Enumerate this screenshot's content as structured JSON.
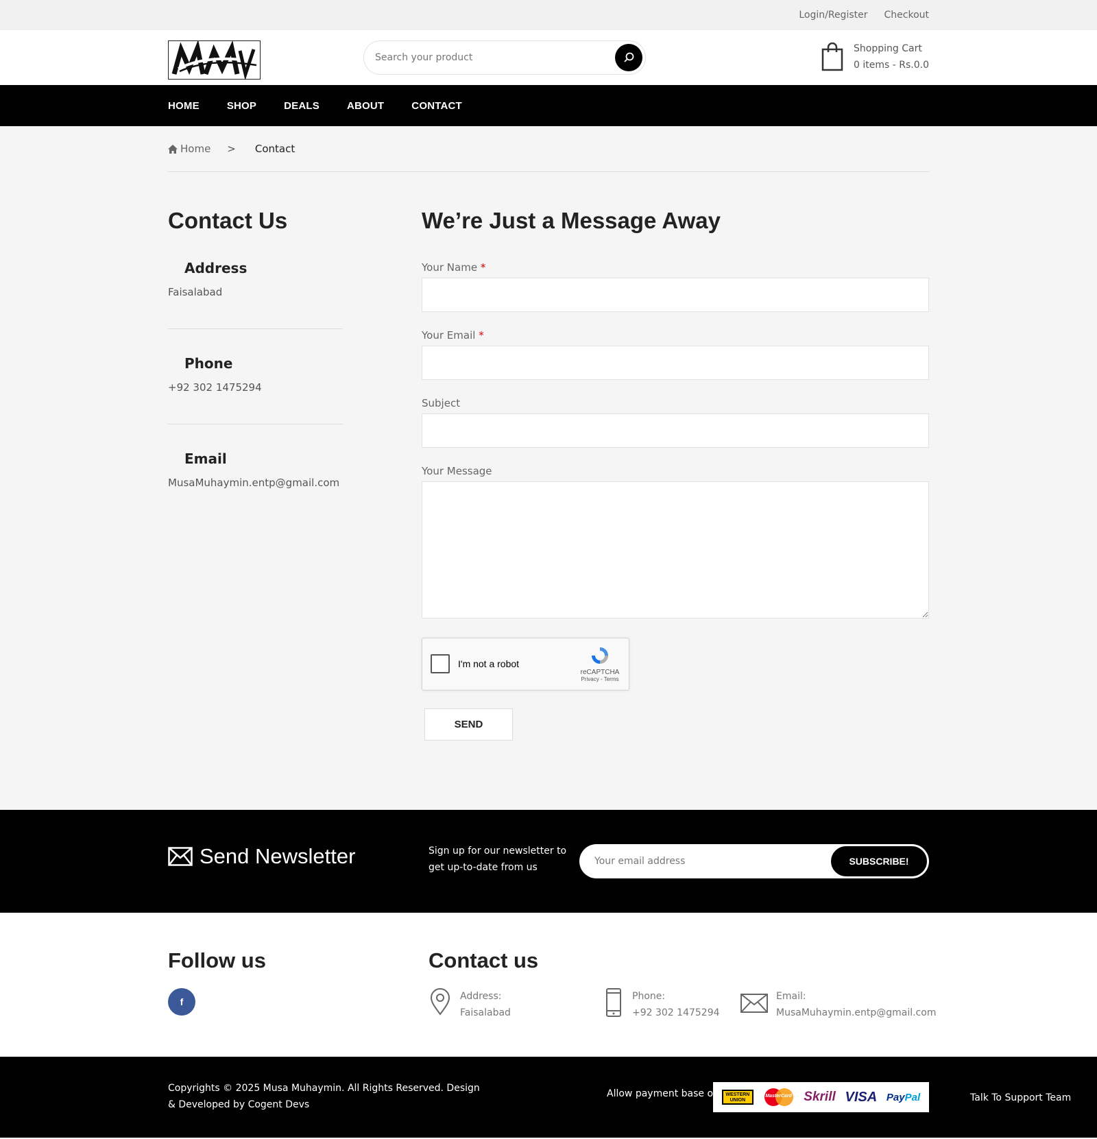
{
  "topbar": {
    "login": "Login/Register",
    "checkout": "Checkout"
  },
  "header": {
    "logo_text": "MM",
    "search_placeholder": "Search your product",
    "cart_title": "Shopping Cart",
    "cart_summary": "0 items - Rs.0.0"
  },
  "nav": {
    "items": [
      "HOME",
      "SHOP",
      "DEALS",
      "ABOUT",
      "CONTACT"
    ]
  },
  "breadcrumb": {
    "home": "Home",
    "separator": ">",
    "current": "Contact"
  },
  "contact_info": {
    "title": "Contact Us",
    "blocks": [
      {
        "label": "Address",
        "value": "Faisalabad"
      },
      {
        "label": "Phone",
        "value": "+92 302 1475294"
      },
      {
        "label": "Email",
        "value": "MusaMuhaymin.entp@gmail.com"
      }
    ]
  },
  "form": {
    "title": "We’re Just a Message Away",
    "name_label": "Your Name",
    "email_label": "Your Email",
    "subject_label": "Subject",
    "message_label": "Your Message",
    "required_mark": "*",
    "captcha_label": "I'm not a robot",
    "captcha_brand": "reCAPTCHA",
    "captcha_links": "Privacy - Terms",
    "send_label": "SEND"
  },
  "newsletter": {
    "title": "Send Newsletter",
    "description": "Sign up for our newsletter to get up-to-date from us",
    "placeholder": "Your email address",
    "button": "SUBSCRIBE!"
  },
  "footer": {
    "follow_title": "Follow us",
    "facebook_letter": "f",
    "contact_title": "Contact us",
    "address_label": "Address:",
    "address_value": "Faisalabad",
    "phone_label": "Phone:",
    "phone_value": "+92 302 1475294",
    "email_label": "Email:",
    "email_value": "MusaMuhaymin.entp@gmail.com"
  },
  "bottom": {
    "copyright": "Copyrights © 2025 Musa Muhaymin. All Rights Reserved. Design & Developed by Cogent Devs",
    "payment_label": "Allow payment base on",
    "payment_methods": {
      "western_union": "WESTERN UNION",
      "mastercard": "MasterCard",
      "skrill": "Skrill",
      "visa": "VISA",
      "paypal_a": "Pay",
      "paypal_b": "Pal"
    },
    "support": "Talk To Support Team"
  },
  "colors": {
    "primary": "#000000",
    "accent_required": "#dd0000",
    "facebook": "#3b5998"
  }
}
